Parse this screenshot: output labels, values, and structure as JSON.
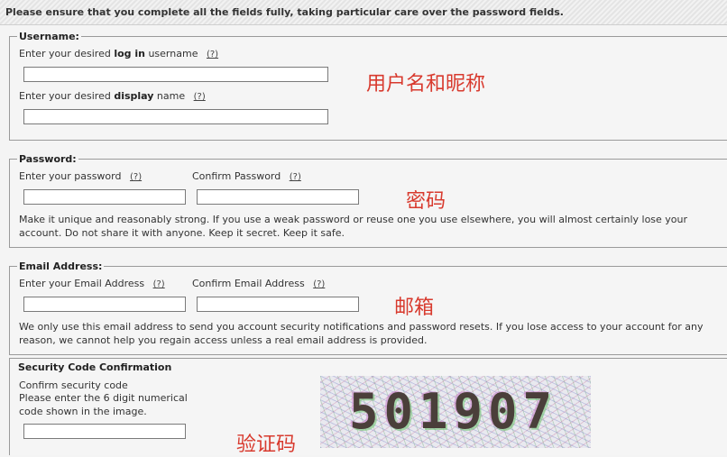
{
  "header": {
    "message": "Please ensure that you complete all the fields fully, taking particular care over the password fields."
  },
  "username": {
    "legend": "Username:",
    "login_prefix": "Enter your desired ",
    "login_bold": "log in",
    "login_suffix": " username",
    "display_prefix": "Enter your desired ",
    "display_bold": "display",
    "display_suffix": " name",
    "annotation": "用户名和昵称"
  },
  "password": {
    "legend": "Password:",
    "enter_label": "Enter your password",
    "confirm_label": "Confirm Password",
    "note": "Make it unique and reasonably strong. If you use a weak password or reuse one you use elsewhere, you will almost certainly lose your account. Do not share it with anyone. Keep it secret. Keep it safe.",
    "annotation": "密码"
  },
  "email": {
    "legend": "Email Address:",
    "enter_label": "Enter your Email Address",
    "confirm_label": "Confirm Email Address",
    "note": "We only use this email address to send you account security notifications and password resets. If you lose access to your account for any reason, we cannot help you regain access unless a real email address is provided.",
    "annotation": "邮箱"
  },
  "security": {
    "title": "Security Code Confirmation",
    "line1": "Confirm security code",
    "line2": "Please enter the 6 digit numerical",
    "line3": "code shown in the image.",
    "captcha_text": "501907",
    "annotation": "验证码"
  },
  "help_link": "(?)",
  "colors": {
    "annotation_red": "#d83a2e",
    "border": "#9a9a9a"
  }
}
